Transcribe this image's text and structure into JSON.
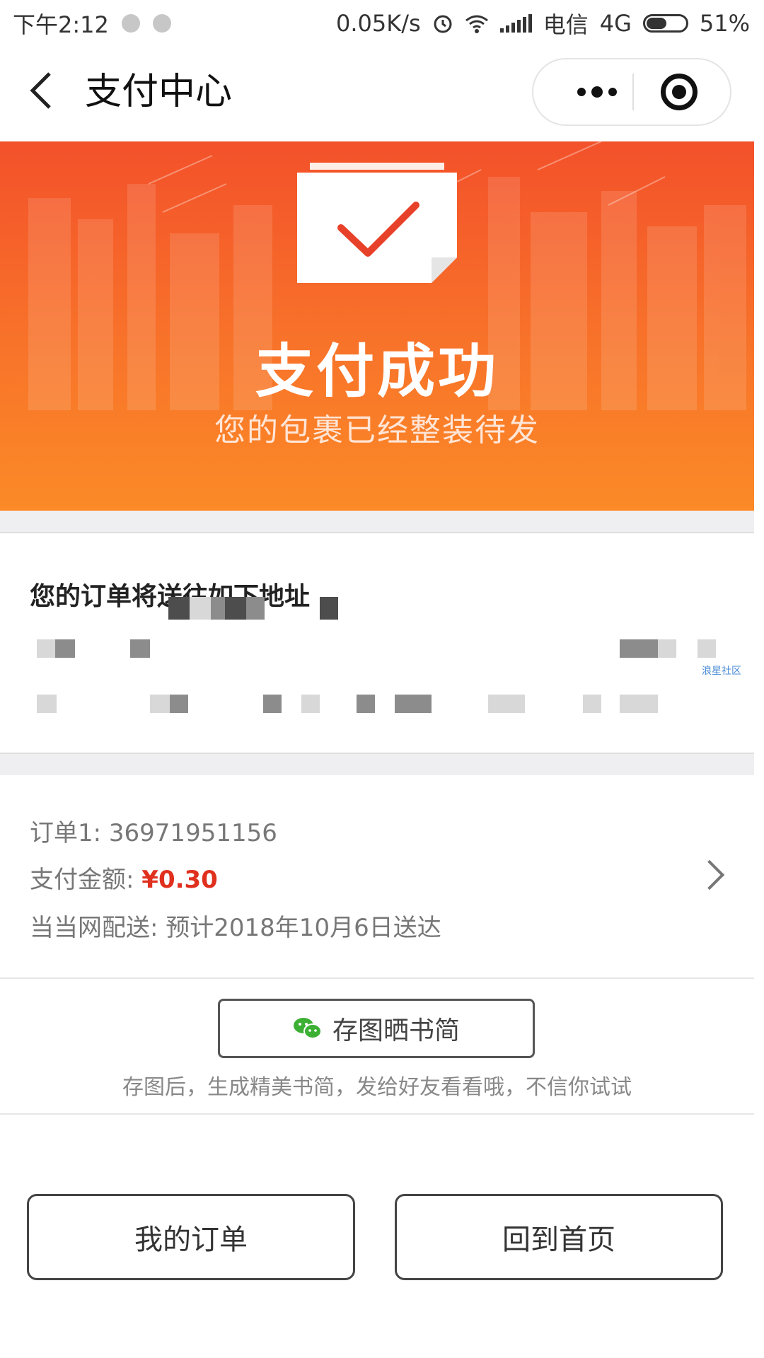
{
  "status_bar": {
    "time": "下午2:12",
    "network_speed": "0.05K/s",
    "carrier": "电信",
    "network_type": "4G",
    "battery": "51%"
  },
  "nav": {
    "title": "支付中心",
    "back_icon": "chevron-left-icon",
    "more_icon": "more-dots-icon",
    "close_icon": "target-circle-icon"
  },
  "banner": {
    "title": "支付成功",
    "subtitle": "您的包裹已经整装待发",
    "gradient_top": "#f3512a",
    "gradient_bottom": "#fb8a27"
  },
  "address": {
    "heading": "您的订单将送往如下地址",
    "watermark": "浪星社区"
  },
  "order": {
    "order_label": "订单1:",
    "order_number": "36971951156",
    "amount_label": "支付金额:",
    "amount_value": "¥0.30",
    "delivery_label": "当当网配送:",
    "delivery_estimate": "预计2018年10月6日送达",
    "amount_color": "#e0301e"
  },
  "share": {
    "button_label": "存图晒书简",
    "button_icon": "wechat-icon",
    "hint": "存图后，生成精美书简，发给好友看看哦，不信你试试"
  },
  "actions": {
    "my_orders": "我的订单",
    "back_home": "回到首页"
  }
}
